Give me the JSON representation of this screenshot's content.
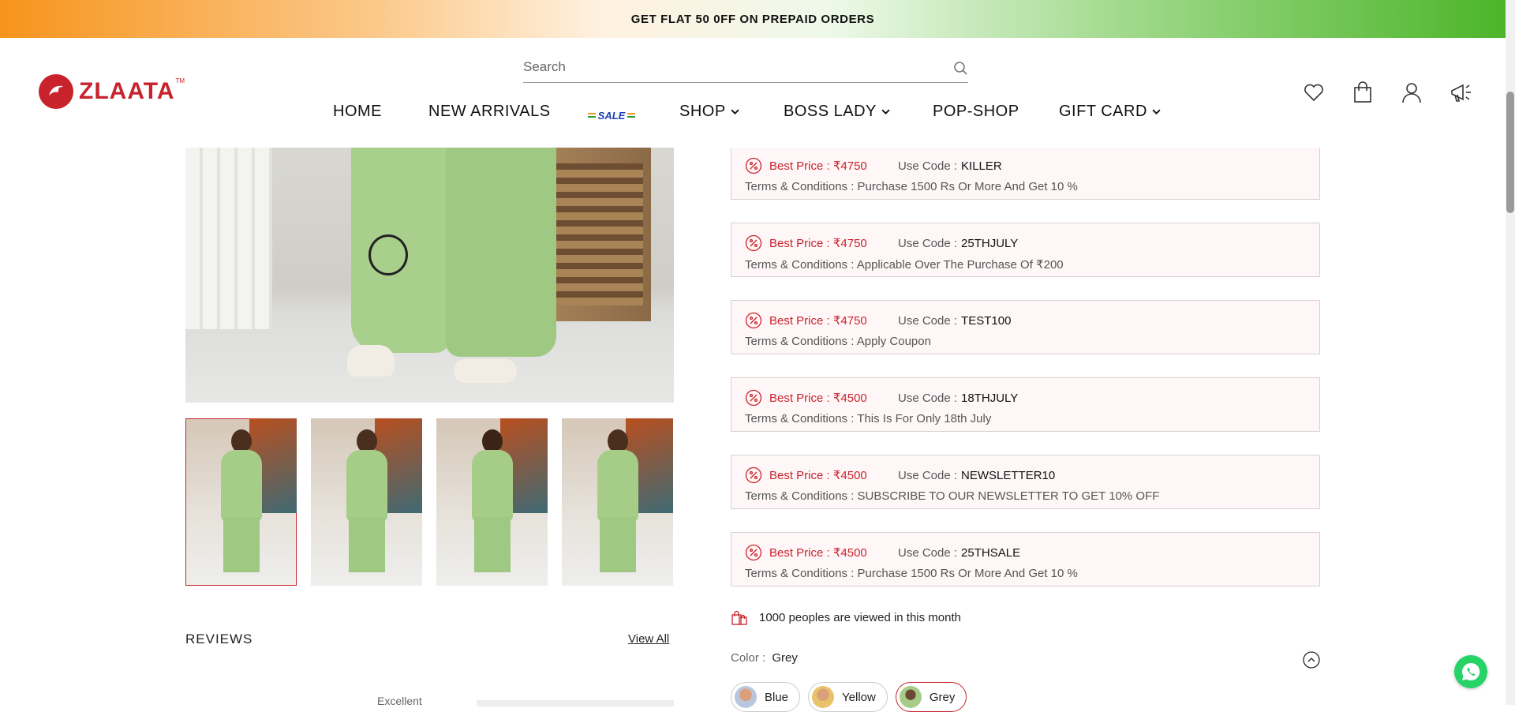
{
  "promo": {
    "text": "GET FLAT 50 0FF ON PREPAID ORDERS"
  },
  "brand": {
    "name": "ZLAATA",
    "tm": "TM"
  },
  "search": {
    "placeholder": "Search"
  },
  "nav": {
    "items": [
      {
        "label": "HOME",
        "has_dropdown": false
      },
      {
        "label": "NEW ARRIVALS",
        "has_dropdown": false
      },
      {
        "label": "SHOP",
        "has_dropdown": true
      },
      {
        "label": "BOSS LADY",
        "has_dropdown": true
      },
      {
        "label": "POP-SHOP",
        "has_dropdown": false
      },
      {
        "label": "GIFT CARD",
        "has_dropdown": true
      }
    ],
    "sale_badge": "SALE"
  },
  "header_icons": [
    "heart-icon",
    "bag-icon",
    "user-icon",
    "megaphone-icon"
  ],
  "gallery": {
    "thumbnails": [
      {
        "name": "front-view",
        "active": true
      },
      {
        "name": "front-view-2",
        "active": false
      },
      {
        "name": "back-view",
        "active": false
      },
      {
        "name": "side-view",
        "active": false
      }
    ]
  },
  "reviews": {
    "title": "REVIEWS",
    "view_all": "View All",
    "rating_label": "Excellent"
  },
  "offers": [
    {
      "best_price": "Best Price : ₹4750",
      "use_code_label": "Use Code :",
      "code": "KILLER",
      "terms": "Terms & Conditions : Purchase 1500 Rs Or More And Get 10 %"
    },
    {
      "best_price": "Best Price : ₹4750",
      "use_code_label": "Use Code :",
      "code": "25THJULY",
      "terms": "Terms & Conditions : Applicable Over The Purchase Of ₹200"
    },
    {
      "best_price": "Best Price : ₹4750",
      "use_code_label": "Use Code :",
      "code": "TEST100",
      "terms": "Terms & Conditions : Apply Coupon"
    },
    {
      "best_price": "Best Price : ₹4500",
      "use_code_label": "Use Code :",
      "code": "18THJULY",
      "terms": "Terms & Conditions : This Is For Only 18th July"
    },
    {
      "best_price": "Best Price : ₹4500",
      "use_code_label": "Use Code :",
      "code": "NEWSLETTER10",
      "terms": "Terms & Conditions : SUBSCRIBE TO OUR NEWSLETTER TO GET 10% OFF"
    },
    {
      "best_price": "Best Price : ₹4500",
      "use_code_label": "Use Code :",
      "code": "25THSALE",
      "terms": "Terms & Conditions : Purchase 1500 Rs Or More And Get 10 %"
    }
  ],
  "views": {
    "text": "1000 peoples are viewed in this month"
  },
  "color": {
    "label": "Color :",
    "selected": "Grey",
    "options": [
      {
        "label": "Blue",
        "active": false
      },
      {
        "label": "Yellow",
        "active": false
      },
      {
        "label": "Grey",
        "active": true
      }
    ]
  },
  "colors": {
    "accent": "#c8232c",
    "offer_bg": "#fff7f7",
    "whatsapp": "#25d366"
  }
}
